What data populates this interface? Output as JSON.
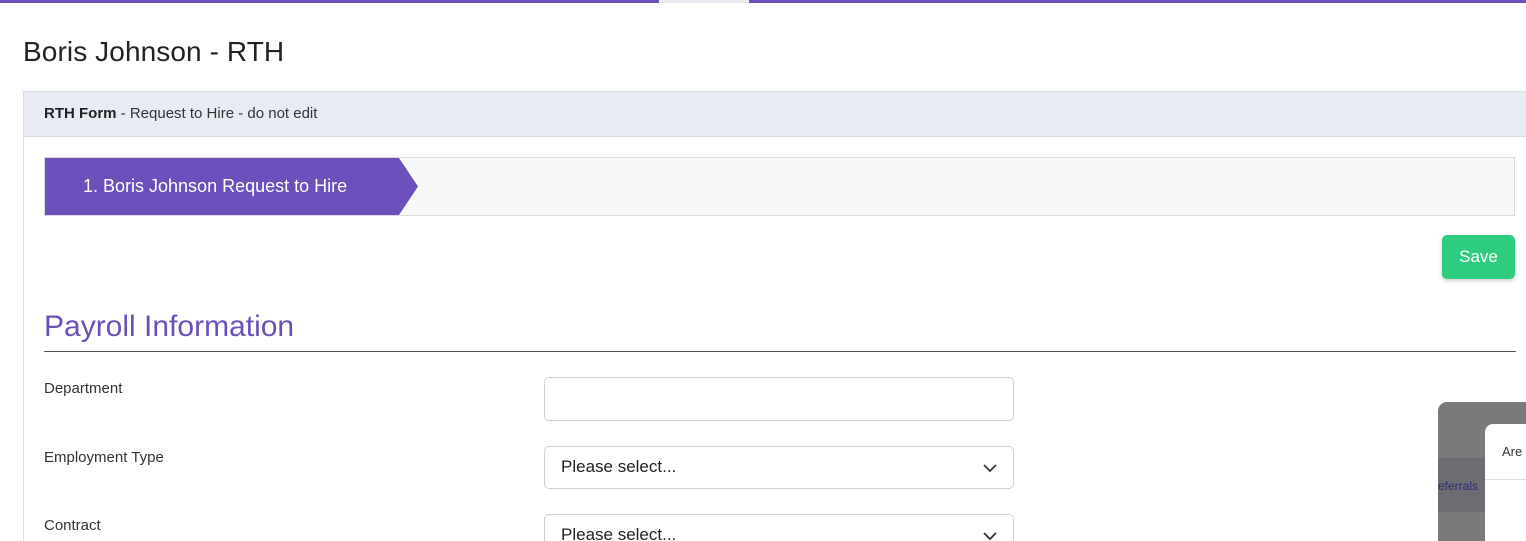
{
  "page": {
    "title": "Boris Johnson - RTH"
  },
  "card": {
    "header_bold": "RTH Form",
    "header_rest": " - Request to Hire - do not edit"
  },
  "stepper": {
    "steps": [
      {
        "label": "1. Boris Johnson Request to Hire",
        "active": true
      }
    ]
  },
  "actions": {
    "save_label": "Save"
  },
  "section": {
    "title": "Payroll Information"
  },
  "fields": [
    {
      "label": "Department",
      "type": "text",
      "value": ""
    },
    {
      "label": "Employment Type",
      "type": "select",
      "value": "Please select..."
    },
    {
      "label": "Contract",
      "type": "select",
      "value": "Please select..."
    }
  ],
  "overlay": {
    "strip_text": "eferrals",
    "panel_text": "Are"
  },
  "colors": {
    "accent": "#6b4fbb",
    "save": "#2ecc7f",
    "header_bg": "#e8eaf4"
  }
}
